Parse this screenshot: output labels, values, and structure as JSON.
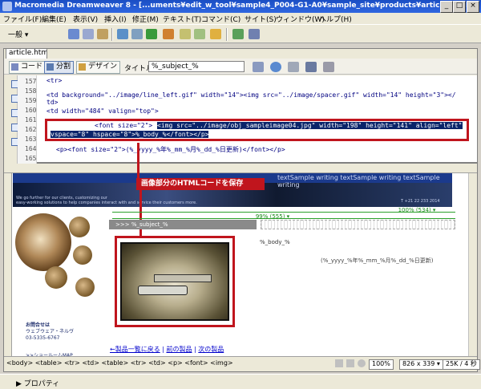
{
  "window": {
    "title": "Macromedia Dreamweaver 8 - [...uments¥edit_w_tool¥sample4_P004-G1-A0¥sample_site¥products¥article.html*]"
  },
  "menu": [
    "ファイル(F)",
    "編集(E)",
    "表示(V)",
    "挿入(I)",
    "修正(M)",
    "テキスト(T)",
    "コマンド(C)",
    "サイト(S)",
    "ウィンドウ(W)",
    "ヘルプ(H)"
  ],
  "insert_bar": {
    "category": "一般 ▾"
  },
  "document": {
    "tab": "article.html*",
    "views": {
      "code": "コード",
      "split": "分割",
      "design": "デザイン"
    },
    "title_label": "タイトル :",
    "title_value": "%_subject_%"
  },
  "code": {
    "line_numbers": [
      "157",
      "158",
      "159",
      "160",
      "161",
      "162",
      "163",
      "164",
      "165"
    ],
    "lines": [
      "<tr>",
      "<td background=\"../image/line_left.gif\" width=\"14\"><img src=\"../image/spacer.gif\" width=\"14\" height=\"3\"></",
      "td>",
      "<td width=\"484\" valign=\"top\">",
      "",
      "<font size=\"2\">",
      "<img src=\"../image/obj_sampleimage04.jpg\" width=\"198\" height=\"141\" align=\"left\"",
      "vspace=\"8\" hspace=\"8\">%_body_%</font></p>",
      "<p><font size=\"2\">(%_yyyy_%年%_mm_%月%_dd_%日更新)</font></p>"
    ]
  },
  "callout": "画像部分のHTMLコードを保存",
  "design": {
    "banner_strip": "textSample writing textSample writing textSample writing",
    "banner_body": "We go further for our clients, customizing our\neasy-working solutions to help companies interact with and service their customers more.",
    "banner_tel": "T +21 22 233 2014",
    "width_100": "100% (534) ▾",
    "width_99": "99% (555) ▾",
    "subject": ">>> %_subject_%",
    "body": "%_body_%",
    "date": "(%_yyyy_%年%_mm_%月%_dd_%日更新)",
    "contact_title": "お問合せは",
    "contact_company": "ウェブウェア・ネルヴ",
    "contact_phone": "03-5335-6767",
    "showroom": ">>ショールームMAP",
    "nav": [
      "←製品一覧に戻る",
      "前の製品",
      "次の製品"
    ]
  },
  "status": {
    "tags": "<body> <table> <tr> <td> <table> <tr> <td> <p> <font> <img>",
    "zoom": "100%",
    "size": "826 x 339 ▾",
    "filesize": "25K / 4 秒"
  },
  "panel": {
    "properties": "▶ プロパティ"
  }
}
